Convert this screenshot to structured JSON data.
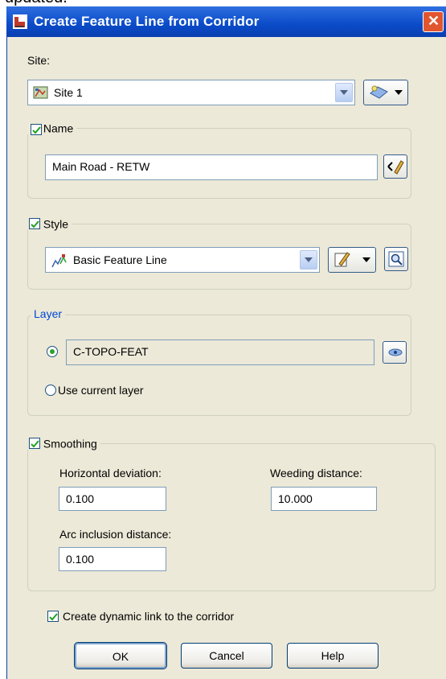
{
  "header_fragment": "updated.",
  "dialog": {
    "title": "Create Feature Line from Corridor",
    "close_icon": "close-icon"
  },
  "site": {
    "label": "Site:",
    "value": "Site 1",
    "icon": "site-icon"
  },
  "name": {
    "label": "Name",
    "checked": true,
    "value": "Main Road - RETW"
  },
  "style": {
    "label": "Style",
    "checked": true,
    "value": "Basic Feature Line",
    "icon": "feature-line-style-icon"
  },
  "layer": {
    "label": "Layer",
    "option_specific_value": "C-TOPO-FEAT",
    "option_current_label": "Use current layer",
    "selected": "specific"
  },
  "smoothing": {
    "label": "Smoothing",
    "checked": true,
    "horizontal_deviation_label": "Horizontal deviation:",
    "horizontal_deviation_value": "0.100",
    "weeding_distance_label": "Weeding distance:",
    "weeding_distance_value": "10.000",
    "arc_inclusion_label": "Arc inclusion distance:",
    "arc_inclusion_value": "0.100"
  },
  "dynamic_link": {
    "label": "Create dynamic link to the corridor",
    "checked": true
  },
  "buttons": {
    "ok": "OK",
    "cancel": "Cancel",
    "help": "Help"
  },
  "colors": {
    "titlebar": "#0a4bc8",
    "dialog_bg": "#ece9d8",
    "layer_legend": "#0046d5",
    "check_green": "#21a121"
  }
}
